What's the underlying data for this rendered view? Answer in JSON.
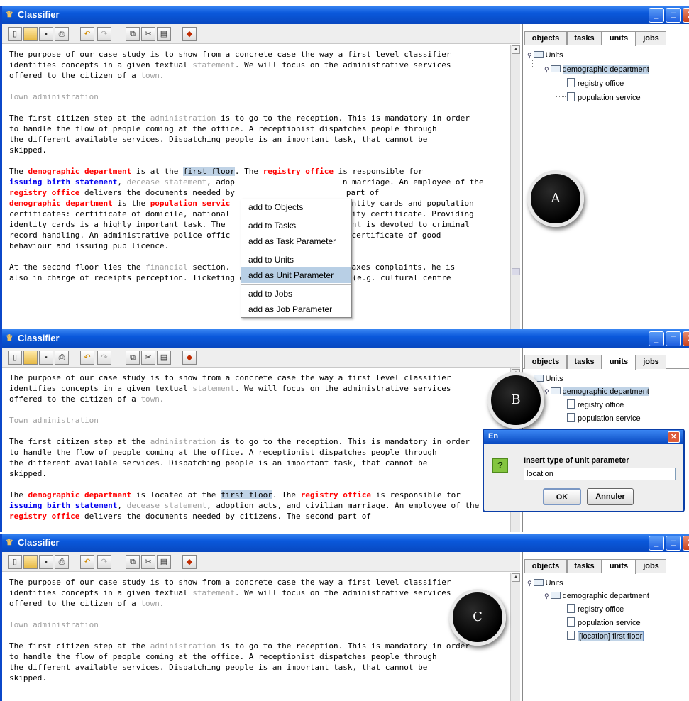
{
  "app": {
    "title": "Classifier"
  },
  "window_buttons": {
    "minimize": "_",
    "maximize": "□",
    "close": "X"
  },
  "toolbar": [
    "new-icon",
    "open-icon",
    "save-icon",
    "print-icon",
    "undo-icon",
    "redo-icon",
    "copy-icon",
    "cut-icon",
    "paste-icon",
    "classify-icon"
  ],
  "tabs": [
    "objects",
    "tasks",
    "units",
    "jobs"
  ],
  "active_tab": "units",
  "doc": {
    "p1": [
      "The purpose of our case study is to show from a concrete case the way a first level classifier",
      "identifies concepts in a given textual ",
      "statement",
      ". We will focus on the administrative services",
      "offered to the citizen of a ",
      "town",
      "."
    ],
    "heading": "Town administration",
    "p2": [
      "The first citizen step at the ",
      "administration",
      " is to go to the reception. This is mandatory in order",
      "to handle the flow of people coming at the office. A receptionist dispatches people through",
      "the different available services. Dispatching people is an important task, that cannot be",
      "skipped."
    ],
    "p3_a": {
      "l1": [
        "The ",
        "demographic department",
        " is at the ",
        "first floor",
        ". The ",
        "registry office",
        " is responsible for"
      ],
      "l2": [
        "issuing birth statement",
        ", ",
        "decease statement",
        ", adop",
        "n marriage. An employee of the"
      ],
      "l3": [
        "registry office",
        " delivers the documents needed by",
        "part of"
      ],
      "l4": [
        "demographic department",
        " is the ",
        "population servic",
        "dentity cards and population"
      ],
      "l5": [
        "certificates: certificate of domicile, national",
        "edity certificate. Providing"
      ],
      "l6": [
        "identity cards is a highly important task. The ",
        "tment",
        " is devoted to criminal"
      ],
      "l7": [
        "record handling. An administrative police offic",
        "g certificate of good"
      ],
      "l8": "behaviour and issuing pub licence.",
      "l9": [
        "At the second floor lies the ",
        "financial",
        " section.",
        " taxes complaints, he is"
      ],
      "l10": [
        "also in charge of receipts perception. Ticketing of some punctual events (e.g. cultural centre"
      ]
    },
    "p3_b": {
      "l1": [
        "The ",
        "demographic department",
        " is located at the ",
        "first floor",
        ". The ",
        "registry office",
        " is responsible for"
      ],
      "l2": [
        "issuing birth statement",
        ", ",
        "decease statement",
        ", adoption acts, and civilian marriage. An employee of the"
      ],
      "l3": [
        "registry office",
        " delivers the documents needed by citizens. The second part of"
      ]
    }
  },
  "tree_a": {
    "root": "Units",
    "dept": "demographic department",
    "child1": "registry office",
    "child2": "population service"
  },
  "tree_c": {
    "child3": "[location] first floor"
  },
  "context_menu": [
    "add to Objects",
    "add to Tasks",
    "add as Task Parameter",
    "add to Units",
    "add as Unit Parameter",
    "add to Jobs",
    "add as Job Parameter"
  ],
  "dialog": {
    "title": "En",
    "prompt": "Insert type of unit parameter",
    "value": "location",
    "ok": "OK",
    "cancel": "Annuler",
    "question_glyph": "?"
  },
  "markers": {
    "a": "A",
    "b": "B",
    "c": "C"
  },
  "colors": {
    "title_blue": "#0a58db",
    "keyword_red": "#ff0000",
    "keyword_blue": "#0000ee",
    "concept_gray": "#a0a0a0",
    "selection": "#c0d3e6"
  }
}
